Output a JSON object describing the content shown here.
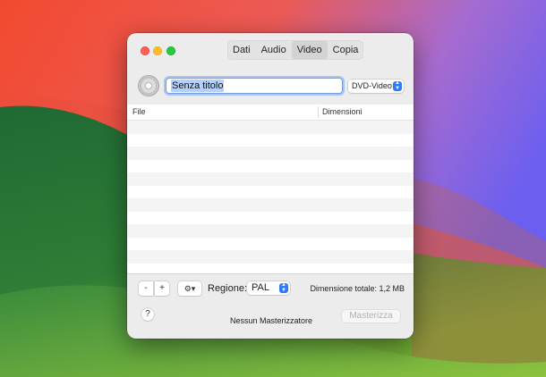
{
  "desktop": {
    "wallpaper_colors": [
      "#f0442f",
      "#e85a4e",
      "#8c6fd8",
      "#6b5ff0",
      "#2e7a3a",
      "#6fab3a"
    ]
  },
  "window": {
    "tabs": [
      {
        "label": "Dati",
        "active": false
      },
      {
        "label": "Audio",
        "active": false
      },
      {
        "label": "Video",
        "active": true
      },
      {
        "label": "Copia",
        "active": false
      }
    ],
    "disc_icon": "disc-icon",
    "title_field": {
      "value": "Senza titolo"
    },
    "format_select": {
      "value": "DVD-Video"
    },
    "list": {
      "columns": [
        "File",
        "Dimensioni"
      ],
      "rows": []
    },
    "toolbar": {
      "minus_label": "-",
      "plus_label": "+",
      "gear_label": "⚙▾",
      "region_label": "Regione:",
      "region_value": "PAL",
      "total_size": "Dimensione totale: 1,2 MB"
    },
    "footer": {
      "help_label": "?",
      "burner_status": "Nessun Masterizzatore",
      "burn_label": "Masterizza"
    }
  }
}
